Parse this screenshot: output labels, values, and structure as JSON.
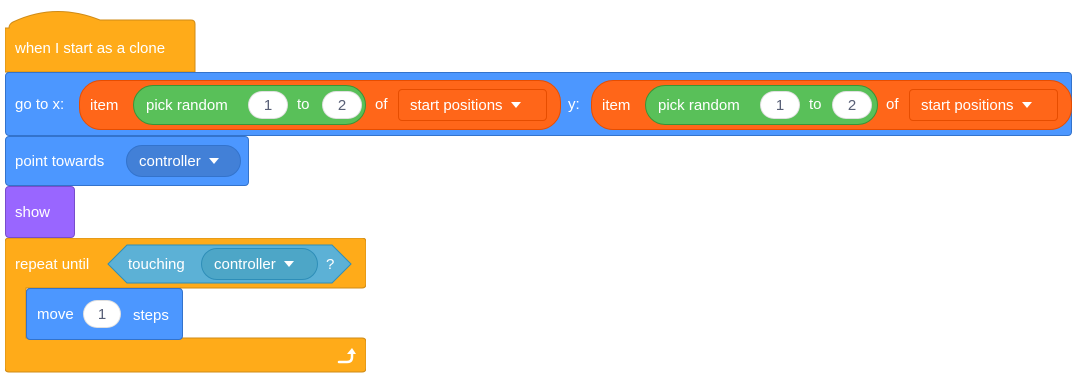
{
  "hat": {
    "label": "when I start as a clone"
  },
  "goto": {
    "label": "go to x:",
    "x": {
      "item_label": "item",
      "random_label": "pick random",
      "from": "1",
      "to_label": "to",
      "to": "2",
      "of_label": "of",
      "list": "start positions"
    },
    "y_label": "y:",
    "y": {
      "item_label": "item",
      "random_label": "pick random",
      "from": "1",
      "to_label": "to",
      "to": "2",
      "of_label": "of",
      "list": "start positions"
    }
  },
  "point": {
    "label": "point towards",
    "target": "controller"
  },
  "show": {
    "label": "show"
  },
  "repeat": {
    "label": "repeat until",
    "touching_label": "touching",
    "touching_target": "controller",
    "question": "?"
  },
  "move": {
    "label": "move",
    "steps": "1",
    "steps_label": "steps"
  },
  "icons": {
    "loop": "loop-arrow-icon",
    "caret": "dropdown-caret-icon"
  },
  "colors": {
    "events": "#FFAB19",
    "motion": "#4C97FF",
    "looks": "#9966FF",
    "control": "#FFAB19",
    "operators": "#59C059",
    "lists": "#FF6619",
    "sensing": "#5CB1D6"
  }
}
